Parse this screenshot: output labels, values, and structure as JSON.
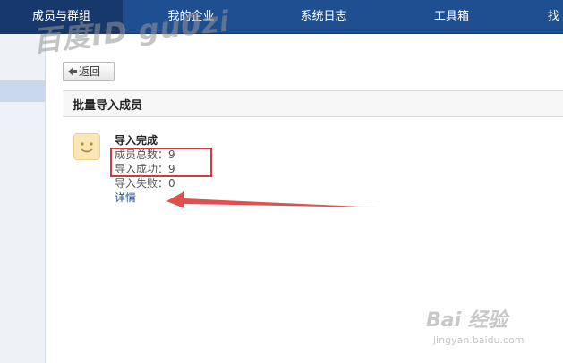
{
  "nav": {
    "tabs": [
      {
        "label": "成员与群组"
      },
      {
        "label": "我的企业"
      },
      {
        "label": "系统日志"
      },
      {
        "label": "工具箱"
      },
      {
        "label": "找"
      }
    ]
  },
  "watermark": "百度ID gu0zi",
  "back_label": "返回",
  "section_title": "批量导入成员",
  "result": {
    "title": "导入完成",
    "total": "成员总数：9",
    "success": "导入成功：9",
    "fail": "导入失败：0",
    "detail_link": "详情"
  },
  "baidu_watermark": {
    "brand": "Bai  经验",
    "site": "jingyan.baidu.com"
  },
  "colors": {
    "nav_bg": "#1f4f91",
    "highlight": "#d03a3a",
    "link": "#1f4f91"
  }
}
